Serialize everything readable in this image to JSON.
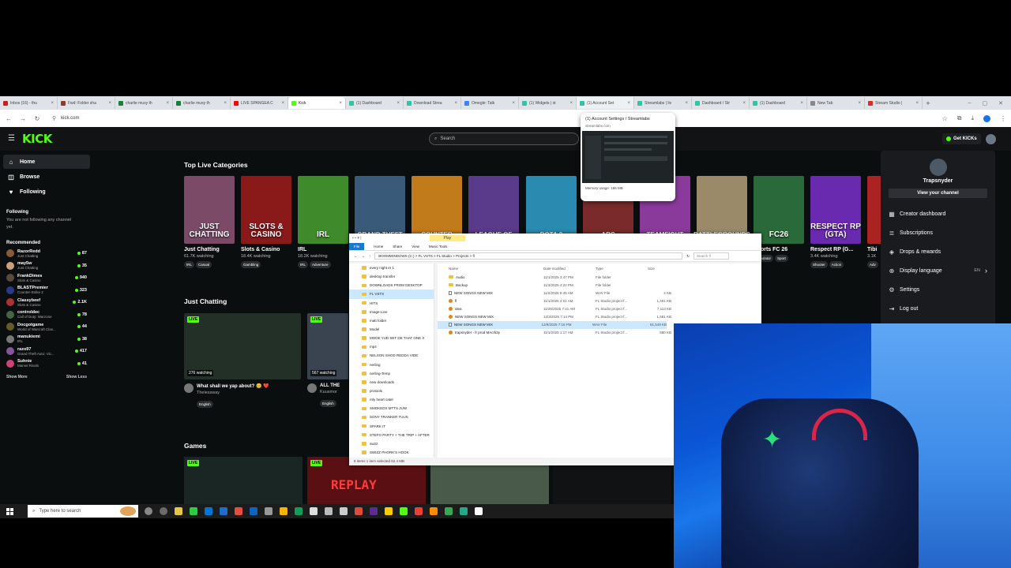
{
  "browser": {
    "tabs": [
      {
        "title": "Inbox (16) - thu",
        "color": "#c5221f"
      },
      {
        "title": "Fwd: Folder sha",
        "color": "#8c3b2c"
      },
      {
        "title": "charlie musy th",
        "color": "#188038"
      },
      {
        "title": "charlie musy th",
        "color": "#188038"
      },
      {
        "title": "LIVE SPANGEA C",
        "color": "#ff0000"
      },
      {
        "title": "Kick",
        "color": "#53fc18"
      },
      {
        "title": "(1) Dashboard",
        "color": "#31c3a2"
      },
      {
        "title": "Download Strea",
        "color": "#31c3a2"
      },
      {
        "title": "Omegle: Talk",
        "color": "#3b82f6"
      },
      {
        "title": "(1) Widgets | st",
        "color": "#31c3a2"
      },
      {
        "title": "(1) Account Set",
        "color": "#31c3a2"
      },
      {
        "title": "Streamlabs | liv",
        "color": "#31c3a2"
      },
      {
        "title": "Dashboard / Str",
        "color": "#31c3a2"
      },
      {
        "title": "(1) Dashboard",
        "color": "#31c3a2"
      },
      {
        "title": "New Tab",
        "color": "#888888"
      },
      {
        "title": "Stream Studio |",
        "color": "#d93025"
      }
    ],
    "url": "kick.com",
    "preview": {
      "title": "(1) Account Settings / Streamlabs",
      "url": "streamlabs.com",
      "memory": "Memory usage: 186 MB"
    }
  },
  "kick": {
    "logo": "KICK",
    "search_placeholder": "Search",
    "get_kicks": "Get KICKs",
    "nav": [
      {
        "label": "Home",
        "icon": "home-icon"
      },
      {
        "label": "Browse",
        "icon": "browse-icon"
      },
      {
        "label": "Following",
        "icon": "heart-icon"
      }
    ],
    "following_title": "Following",
    "following_note": "You are not following any channel yet.",
    "recommended_title": "Recommended",
    "recommended": [
      {
        "name": "RazorRedd",
        "category": "Just Chatting",
        "viewers": "87",
        "color": "#8a5a3b"
      },
      {
        "name": "may5w",
        "category": "Just Chatting",
        "viewers": "35",
        "color": "#c9a07a"
      },
      {
        "name": "FrankDimes",
        "category": "Slots & Casino",
        "viewers": "940",
        "color": "#5a4a3a"
      },
      {
        "name": "BLASTPremier",
        "category": "Counter-Strike 2",
        "viewers": "323",
        "color": "#2a3a8a"
      },
      {
        "name": "Classybeef",
        "category": "Slots & Casino",
        "viewers": "2.1K",
        "color": "#aa3333"
      },
      {
        "name": "controldec",
        "category": "Call of Duty: Warzone",
        "viewers": "78",
        "color": "#446644"
      },
      {
        "name": "Docgotgame",
        "category": "World of Warcraft Clas...",
        "viewers": "44",
        "color": "#6a5a2a"
      },
      {
        "name": "manukiemi",
        "category": "IRL",
        "viewers": "38",
        "color": "#777777"
      },
      {
        "name": "razo97",
        "category": "Grand Theft Auto: Vic...",
        "viewers": "417",
        "color": "#885599"
      },
      {
        "name": "Suhnie",
        "category": "Marvel Rivals",
        "viewers": "41",
        "color": "#cc4477"
      }
    ],
    "show_more": "Show More",
    "show_less": "Show Less",
    "top_categories_title": "Top Live Categories",
    "categories": [
      {
        "name": "Just Chatting",
        "watching": "61.7K watching",
        "tags": [
          "IRL",
          "Casual"
        ],
        "art": "JUST CHATTING",
        "bg": "#7a4a66"
      },
      {
        "name": "Slots & Casino",
        "watching": "18.4K watching",
        "tags": [
          "Gambling"
        ],
        "art": "SLOTS & CASINO",
        "bg": "#8a1a1a"
      },
      {
        "name": "IRL",
        "watching": "18.2K watching",
        "tags": [
          "IRL",
          "Adventure"
        ],
        "art": "IRL",
        "bg": "#3f8a2a"
      },
      {
        "name": "Sports FC 26",
        "watching": "",
        "tags": [
          "Simulator",
          "Sport"
        ],
        "art": "FC26",
        "bg": "#2a6a3a"
      },
      {
        "name": "Respect RP (G...",
        "watching": "3.4K watching",
        "tags": [
          "Shooter",
          "Action"
        ],
        "art": "RESPECT RP (GTA)",
        "bg": "#6a2ab0"
      },
      {
        "name": "Tibi",
        "watching": "3.1K",
        "tags": [
          "Adv"
        ],
        "art": "",
        "bg": "#aa2222"
      }
    ],
    "partial_categories": [
      {
        "art": "GRAND THEFT",
        "bg": "#3a5a7a"
      },
      {
        "art": "COUNTER",
        "bg": "#c27b1a"
      },
      {
        "art": "LEAGUE OF",
        "bg": "#5a3a8a"
      },
      {
        "art": "DOTA 2",
        "bg": "#2a8ab0"
      },
      {
        "art": "ARC",
        "bg": "#7a2a2a"
      },
      {
        "art": "TEAMFIGHT",
        "bg": "#8a3a9a"
      },
      {
        "art": "BATTLEGROUNDS",
        "bg": "#9a8a6a"
      }
    ],
    "just_chatting_title": "Just Chatting",
    "streams": [
      {
        "viewers": "276 watching",
        "title": "What shall we yap about? 😊 ❤️",
        "streamer": "Thelessway",
        "tag": "English"
      },
      {
        "viewers": "567 watching",
        "title": "ALL THE",
        "streamer": "Kuusmor",
        "tag": "English"
      }
    ],
    "games_title": "Games",
    "live_label": "LIVE",
    "replay_label": "REPLAY",
    "dropdown": {
      "username": "Trapsnyder",
      "view_channel": "View your channel",
      "items": [
        {
          "label": "Creator dashboard",
          "icon": "dashboard-icon"
        },
        {
          "label": "Subscriptions",
          "icon": "subscriptions-icon"
        },
        {
          "label": "Drops & rewards",
          "icon": "drops-icon"
        },
        {
          "label": "Display language",
          "icon": "globe-icon",
          "extra": "EN"
        },
        {
          "label": "Settings",
          "icon": "gear-icon"
        },
        {
          "label": "Log out",
          "icon": "logout-icon"
        }
      ]
    }
  },
  "explorer": {
    "ribbon": [
      "File",
      "Home",
      "Share",
      "View",
      "Music Tools"
    ],
    "play_tab": "Play",
    "path": "BOOMWINDOWS (C:)  >  FL VSTS  >  FL Studio  >  Projects  >  fl",
    "search": "Search fl",
    "nav_items": [
      "every night er 1",
      "desktop transfer",
      "DOWNLOADS FROM DESKTOP",
      "FL VSTS",
      "HITS",
      "Image-Line",
      "matt folder",
      "Model",
      "MODE YUD SET DE THAT ONE X",
      "mp4",
      "NELSON SHOD REDDA VIDE",
      "nerling",
      "nerling-Temp",
      "new downloads",
      "protools",
      "rnly heart cater",
      "SMOKEDS MTTS JUW",
      "SONY TRANKER TUUS",
      "SPARK IT",
      "STEFO PARTY + THE TRIP + AFTER",
      "sw22",
      "SWIZZ PHORK'S HOOK"
    ],
    "nav_selected": 3,
    "columns": [
      "Name",
      "Date modified",
      "Type",
      "Size"
    ],
    "files": [
      {
        "name": "Audio",
        "date": "11/1/2025 3:47 PM",
        "type": "File folder",
        "size": "",
        "kind": "folder"
      },
      {
        "name": "Backup",
        "date": "11/3/2025 4:22 PM",
        "type": "File folder",
        "size": "",
        "kind": "folder"
      },
      {
        "name": "NEW SONGS NEW MIX",
        "date": "11/2/2025 8:45 AM",
        "type": "WAV File",
        "size": "4 KB",
        "kind": "wav"
      },
      {
        "name": "fl",
        "date": "11/1/2025 4:01 AM",
        "type": "FL Studio project f...",
        "size": "1,461 KB",
        "kind": "fl"
      },
      {
        "name": "idea",
        "date": "11/25/2025 7:41 AM",
        "type": "FL Studio project f...",
        "size": "7,113 KB",
        "kind": "fl"
      },
      {
        "name": "NEW SONGS NEW MIX",
        "date": "12/3/2025 7:14 PM",
        "type": "FL Studio project f...",
        "size": "1,581 KB",
        "kind": "fl"
      },
      {
        "name": "NEW SONGS NEW MIX",
        "date": "12/9/2025 7:16 PM",
        "type": "WAV File",
        "size": "61,549 KB",
        "kind": "wav"
      },
      {
        "name": "trapsnyder - fr prod MAcrk3y",
        "date": "11/1/2025 1:17 AM",
        "type": "FL Studio project f...",
        "size": "580 KB",
        "kind": "fl"
      }
    ],
    "selected_file": 6,
    "status": "8 items   1 item selected  62.4 MB"
  },
  "taskbar": {
    "search_placeholder": "Type here to search",
    "apps": [
      "#888888",
      "#6b6b6b",
      "#e8c547",
      "#2ecc40",
      "#0078d4",
      "#1c6fd1",
      "#e74c3c",
      "#0a66c2",
      "#999999",
      "#f4b400",
      "#0f9d58",
      "#dddddd",
      "#bbbbbb",
      "#cccccc",
      "#dd4b39",
      "#5c2d91",
      "#ffcc00",
      "#53fc18",
      "#e94235",
      "#ff8c00",
      "#34a853",
      "#22aa88",
      "#ffffff"
    ]
  }
}
